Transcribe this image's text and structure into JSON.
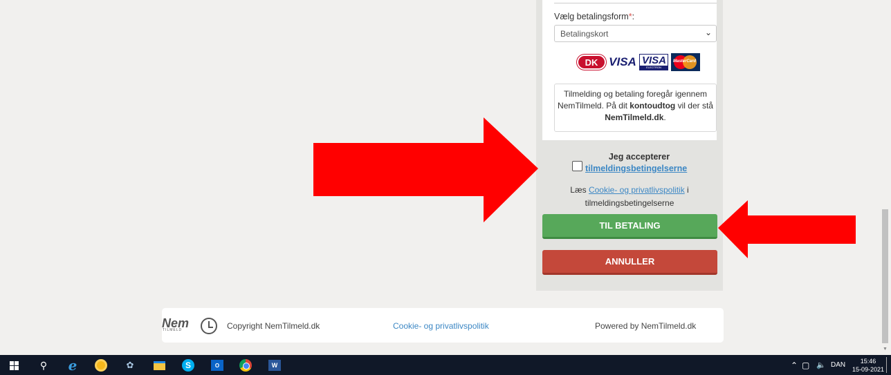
{
  "form": {
    "payment_label": "Vælg betalingsform",
    "required_mark": "*",
    "payment_suffix": ":",
    "payment_selected": "Betalingskort",
    "card_logos": [
      "dankort",
      "visa",
      "visa-electron",
      "mastercard"
    ],
    "card_text": {
      "visa": "VISA",
      "visa_electron": "VISA",
      "electron": "ELECTRON",
      "mastercard": "MasterCard"
    },
    "info": {
      "part1": "Tilmelding og betaling foregår igennem NemTilmeld. På dit ",
      "bold1": "kontoudtog",
      "part2": " vil der stå ",
      "bold2": "NemTilmeld.dk",
      "part3": "."
    },
    "accept_text": "Jeg accepterer",
    "accept_link": "tilmeldingsbetingelserne",
    "accept_checked": false,
    "read_prefix": "Læs ",
    "read_link": "Cookie- og privatlivspolitik",
    "read_suffix": " i",
    "read_line2": "tilmeldingsbetingelserne",
    "pay_button": "TIL BETALING",
    "cancel_button": "ANNULLER"
  },
  "footer": {
    "logo_text": "Nem",
    "logo_sub": "TILMELD",
    "copyright": "Copyright NemTilmeld.dk",
    "cookie_link": "Cookie- og privatlivspolitik",
    "powered": "Powered by NemTilmeld.dk"
  },
  "taskbar": {
    "apps": [
      "windows-start",
      "search",
      "internet-explorer",
      "chrome-canary",
      "snipping-tool",
      "file-explorer",
      "skype",
      "outlook",
      "chrome",
      "word"
    ],
    "tray": {
      "language": "DAN",
      "time": "15:46",
      "date": "15-09-2021"
    }
  },
  "colors": {
    "pay_button": "#57a85a",
    "cancel_button": "#c4483a",
    "link": "#3c87c4",
    "annotation_arrow": "#ff0000"
  }
}
